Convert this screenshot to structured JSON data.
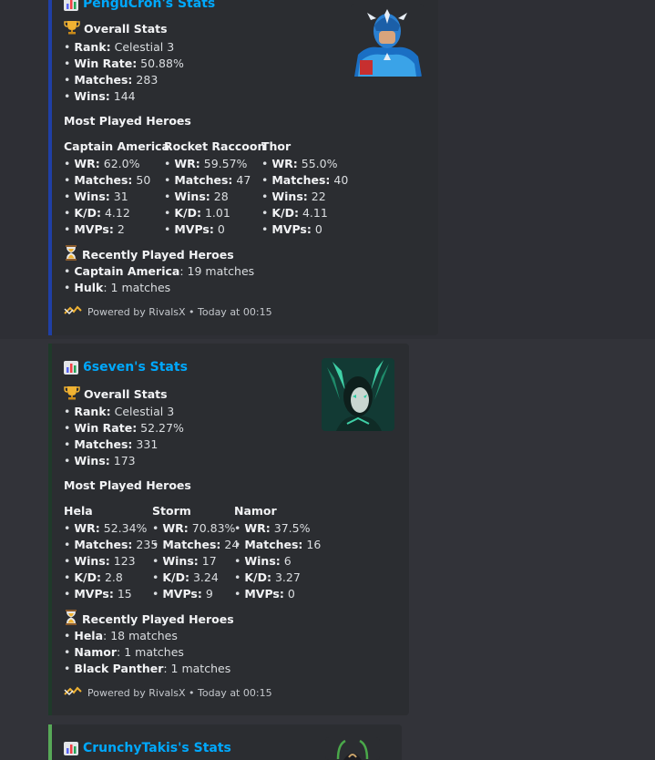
{
  "embeds": [
    {
      "title": "PenguCron's Stats",
      "thumb_icon": "captain-america-portrait",
      "accent": "#1f3fa5",
      "overall_header": "Overall Stats",
      "overall": [
        {
          "k": "Rank:",
          "v": " Celestial 3"
        },
        {
          "k": "Win Rate:",
          "v": " 50.88%"
        },
        {
          "k": "Matches:",
          "v": " 283"
        },
        {
          "k": "Wins:",
          "v": " 144"
        }
      ],
      "most_played_header": "Most Played Heroes",
      "heroes": [
        {
          "name": "Captain America",
          "stats": [
            {
              "k": "WR:",
              "v": " 62.0%"
            },
            {
              "k": "Matches:",
              "v": " 50"
            },
            {
              "k": "Wins:",
              "v": " 31"
            },
            {
              "k": "K/D:",
              "v": " 4.12"
            },
            {
              "k": "MVPs:",
              "v": " 2"
            }
          ]
        },
        {
          "name": "Rocket Raccoon",
          "stats": [
            {
              "k": "WR:",
              "v": " 59.57%"
            },
            {
              "k": "Matches:",
              "v": " 47"
            },
            {
              "k": "Wins:",
              "v": " 28"
            },
            {
              "k": "K/D:",
              "v": " 1.01"
            },
            {
              "k": "MVPs:",
              "v": " 0"
            }
          ]
        },
        {
          "name": "Thor",
          "stats": [
            {
              "k": "WR:",
              "v": " 55.0%"
            },
            {
              "k": "Matches:",
              "v": " 40"
            },
            {
              "k": "Wins:",
              "v": " 22"
            },
            {
              "k": "K/D:",
              "v": " 4.11"
            },
            {
              "k": "MVPs:",
              "v": " 0"
            }
          ]
        }
      ],
      "recent_header": "Recently Played Heroes",
      "recent": [
        {
          "k": "Captain America",
          "v": ": 19 matches"
        },
        {
          "k": "Hulk",
          "v": ": 1 matches"
        }
      ],
      "footer": "Powered by RivalsX • Today at 00:15"
    },
    {
      "title": "6seven's Stats",
      "thumb_icon": "hela-portrait",
      "accent": "#1f3a2a",
      "overall_header": "Overall Stats",
      "overall": [
        {
          "k": "Rank:",
          "v": " Celestial 3"
        },
        {
          "k": "Win Rate:",
          "v": " 52.27%"
        },
        {
          "k": "Matches:",
          "v": " 331"
        },
        {
          "k": "Wins:",
          "v": " 173"
        }
      ],
      "most_played_header": "Most Played Heroes",
      "heroes": [
        {
          "name": "Hela",
          "stats": [
            {
              "k": "WR:",
              "v": " 52.34%"
            },
            {
              "k": "Matches:",
              "v": " 235"
            },
            {
              "k": "Wins:",
              "v": " 123"
            },
            {
              "k": "K/D:",
              "v": " 2.8"
            },
            {
              "k": "MVPs:",
              "v": " 15"
            }
          ]
        },
        {
          "name": "Storm",
          "stats": [
            {
              "k": "WR:",
              "v": " 70.83%"
            },
            {
              "k": "Matches:",
              "v": " 24"
            },
            {
              "k": "Wins:",
              "v": " 17"
            },
            {
              "k": "K/D:",
              "v": " 3.24"
            },
            {
              "k": "MVPs:",
              "v": " 9"
            }
          ]
        },
        {
          "name": "Namor",
          "stats": [
            {
              "k": "WR:",
              "v": " 37.5%"
            },
            {
              "k": "Matches:",
              "v": " 16"
            },
            {
              "k": "Wins:",
              "v": " 6"
            },
            {
              "k": "K/D:",
              "v": " 3.27"
            },
            {
              "k": "MVPs:",
              "v": " 0"
            }
          ]
        }
      ],
      "recent_header": "Recently Played Heroes",
      "recent": [
        {
          "k": "Hela",
          "v": ": 18 matches"
        },
        {
          "k": "Namor",
          "v": ": 1 matches"
        },
        {
          "k": "Black Panther",
          "v": ": 1 matches"
        }
      ],
      "footer": "Powered by RivalsX • Today at 00:15"
    },
    {
      "title": "CrunchyTakis's Stats",
      "thumb_icon": "loki-portrait",
      "accent": "#57a857"
    }
  ]
}
